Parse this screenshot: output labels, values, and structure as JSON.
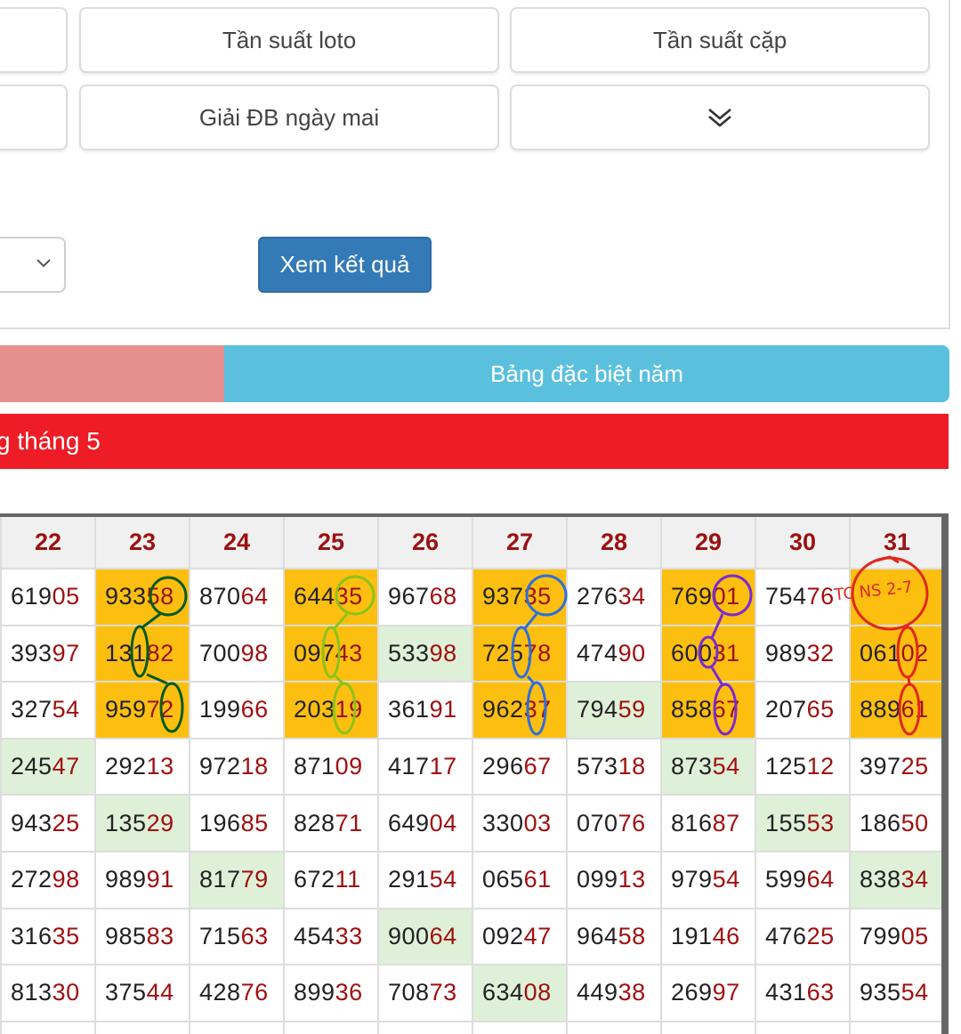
{
  "buttons": {
    "row1": [
      "Tần suất loto",
      "Tần suất cặp"
    ],
    "row2": [
      "Giải ĐB ngày mai"
    ],
    "more_icon": "double-chevron-down-icon"
  },
  "form": {
    "select_icon": "chevron-down-icon",
    "submit_label": "Xem kết quả"
  },
  "tabs": {
    "active_label": "",
    "other_label": "Bảng đặc biệt năm"
  },
  "section_title": "g tháng 5",
  "table": {
    "headers": [
      "22",
      "23",
      "24",
      "25",
      "26",
      "27",
      "28",
      "29",
      "30",
      "31"
    ],
    "rows": [
      [
        "61905",
        "93358",
        "87064",
        "64435",
        "96768",
        "93735",
        "27634",
        "76901",
        "75476",
        ""
      ],
      [
        "39397",
        "13182",
        "70098",
        "09743",
        "53398",
        "72578",
        "47490",
        "60031",
        "98932",
        "06102"
      ],
      [
        "32754",
        "95972",
        "19966",
        "20319",
        "36191",
        "96237",
        "79459",
        "85867",
        "20765",
        "88961"
      ],
      [
        "24547",
        "29213",
        "97218",
        "87109",
        "41717",
        "29667",
        "57318",
        "87354",
        "12512",
        "39725"
      ],
      [
        "94325",
        "13529",
        "19685",
        "82871",
        "64904",
        "33003",
        "07076",
        "81687",
        "15553",
        "18650"
      ],
      [
        "27298",
        "98991",
        "81779",
        "67211",
        "29154",
        "06561",
        "09913",
        "97954",
        "59964",
        "83834"
      ],
      [
        "31635",
        "98583",
        "71563",
        "45433",
        "90064",
        "09247",
        "96458",
        "19146",
        "47625",
        "79905"
      ],
      [
        "81330",
        "37544",
        "42876",
        "89936",
        "70873",
        "63408",
        "44938",
        "26997",
        "43163",
        "93554"
      ],
      [
        "",
        "",
        "",
        "",
        "",
        "",
        "",
        "",
        "",
        ""
      ]
    ],
    "highlight": {
      "yellow": [
        [
          0,
          1
        ],
        [
          1,
          1
        ],
        [
          2,
          1
        ],
        [
          0,
          3
        ],
        [
          1,
          3
        ],
        [
          2,
          3
        ],
        [
          0,
          5
        ],
        [
          1,
          5
        ],
        [
          2,
          5
        ],
        [
          0,
          7
        ],
        [
          1,
          7
        ],
        [
          2,
          7
        ],
        [
          0,
          9
        ],
        [
          1,
          9
        ],
        [
          2,
          9
        ]
      ],
      "green": [
        [
          1,
          4
        ],
        [
          2,
          6
        ],
        [
          3,
          0
        ],
        [
          3,
          7
        ],
        [
          4,
          1
        ],
        [
          4,
          8
        ],
        [
          5,
          2
        ],
        [
          5,
          9
        ],
        [
          6,
          4
        ],
        [
          7,
          5
        ]
      ]
    },
    "colors": {
      "header_text": "#9b1111",
      "tail_digits": "#a01010",
      "yellow": "#fcbf10",
      "green": "#dff0d8"
    }
  },
  "annotations": {
    "handwritten_note": "TC NS 2-7",
    "ink_colors": [
      "#0a5a1a",
      "#8cc21a",
      "#2f6fd6",
      "#7a2bd0",
      "#e0281e"
    ]
  }
}
